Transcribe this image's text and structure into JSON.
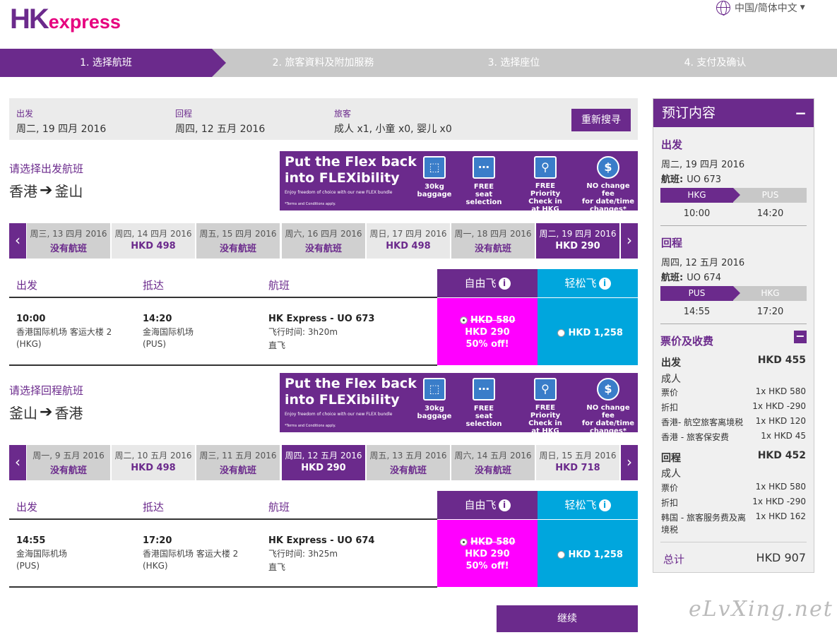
{
  "brand": {
    "logo_hk": "HK",
    "logo_ex": "express"
  },
  "language": {
    "label": "中国/简体中文"
  },
  "steps": [
    "1. 选择航班",
    "2. 旅客資料及附加服務",
    "3. 选择座位",
    "4. 支付及确认"
  ],
  "search": {
    "depart_label": "出发",
    "depart_value": "周二, 19 四月 2016",
    "return_label": "回程",
    "return_value": "周四, 12 五月 2016",
    "pax_label": "旅客",
    "pax_value": "成人 x1, 小童 x0, 婴儿 x0",
    "research_button": "重新搜寻"
  },
  "banner": {
    "title_line1": "Put the Flex back",
    "title_line2": "into FLEXibility",
    "sub": "Enjoy freedom of choice with our new FLEX bundle",
    "terms": "*Terms and Conditions apply.",
    "items": [
      {
        "line1": "30kg",
        "line2": "baggage"
      },
      {
        "line1": "FREE",
        "line2": "seat selection"
      },
      {
        "line1": "FREE",
        "line2": "Priority Check in",
        "line3": "at HKG airport"
      },
      {
        "line1": "NO change fee",
        "line2": "for date/time",
        "line3": "changes*"
      }
    ]
  },
  "outbound": {
    "choose_label": "请选择出发航班",
    "origin": "香港",
    "destination": "釜山",
    "dates": [
      {
        "day": "周三, 13 四月 2016",
        "price": "没有航班"
      },
      {
        "day": "周四, 14 四月 2016",
        "price": "HKD 498"
      },
      {
        "day": "周五, 15 四月 2016",
        "price": "没有航班"
      },
      {
        "day": "周六, 16 四月 2016",
        "price": "没有航班"
      },
      {
        "day": "周日, 17 四月 2016",
        "price": "HKD 498"
      },
      {
        "day": "周一, 18 四月 2016",
        "price": "没有航班"
      },
      {
        "day": "周二, 19 四月 2016",
        "price": "HKD 290"
      }
    ],
    "headers": {
      "depart": "出发",
      "arrive": "抵达",
      "flight": "航班",
      "flex": "自由飞",
      "easy": "轻松飞"
    },
    "flight": {
      "dep_time": "10:00",
      "dep_airport": "香港国际机场 客运大楼 2",
      "dep_code": "(HKG)",
      "arr_time": "14:20",
      "arr_airport": "金海国际机场",
      "arr_code": "(PUS)",
      "name": "HK Express - UO 673",
      "duration": "飞行时间: 3h20m",
      "type": "直飞",
      "flex_old": "HKD 580",
      "flex_price": "HKD 290",
      "flex_off": "50% off!",
      "easy_price": "HKD 1,258"
    }
  },
  "inbound": {
    "choose_label": "请选择回程航班",
    "origin": "釜山",
    "destination": "香港",
    "dates": [
      {
        "day": "周一, 9 五月 2016",
        "price": "没有航班"
      },
      {
        "day": "周二, 10 五月 2016",
        "price": "HKD 498"
      },
      {
        "day": "周三, 11 五月 2016",
        "price": "没有航班"
      },
      {
        "day": "周四, 12 五月 2016",
        "price": "HKD 290"
      },
      {
        "day": "周五, 13 五月 2016",
        "price": "没有航班"
      },
      {
        "day": "周六, 14 五月 2016",
        "price": "没有航班"
      },
      {
        "day": "周日, 15 五月 2016",
        "price": "HKD 718"
      }
    ],
    "headers": {
      "depart": "出发",
      "arrive": "抵达",
      "flight": "航班",
      "flex": "自由飞",
      "easy": "轻松飞"
    },
    "flight": {
      "dep_time": "14:55",
      "dep_airport": "金海国际机场",
      "dep_code": "(PUS)",
      "arr_time": "17:20",
      "arr_airport": "香港国际机场 客运大楼 2",
      "arr_code": "(HKG)",
      "name": "HK Express - UO 674",
      "duration": "飞行时间: 3h25m",
      "type": "直飞",
      "flex_old": "HKD 580",
      "flex_price": "HKD 290",
      "flex_off": "50% off!",
      "easy_price": "HKD 1,258"
    }
  },
  "continue_button": "继续",
  "summary": {
    "title": "预订内容",
    "collapse": "−",
    "depart_title": "出发",
    "depart_date": "周二, 19 四月 2016",
    "depart_flight_label": "航班:",
    "depart_flight": "UO 673",
    "depart_from": "HKG",
    "depart_to": "PUS",
    "depart_t1": "10:00",
    "depart_t2": "14:20",
    "return_title": "回程",
    "return_date": "周四, 12 五月 2016",
    "return_flight_label": "航班:",
    "return_flight": "UO 674",
    "return_from": "PUS",
    "return_to": "HKG",
    "return_t1": "14:55",
    "return_t2": "17:20",
    "fees_title": "票价及收费",
    "fees_toggle": "−",
    "out_label": "出发",
    "out_total": "HKD 455",
    "out_adult": "成人",
    "out_items": [
      {
        "name": "票价",
        "value": "1x HKD 580"
      },
      {
        "name": "折扣",
        "value": "1x HKD -290"
      },
      {
        "name": "香港- 航空旅客离境税",
        "value": "1x HKD 120"
      },
      {
        "name": "香港 - 旅客保安费",
        "value": "1x HKD 45"
      }
    ],
    "ret_label": "回程",
    "ret_total": "HKD 452",
    "ret_adult": "成人",
    "ret_items": [
      {
        "name": "票价",
        "value": "1x HKD 580"
      },
      {
        "name": "折扣",
        "value": "1x HKD -290"
      },
      {
        "name": "韩国 - 旅客服务费及离",
        "name2": "境税",
        "value": "1x HKD 162"
      }
    ],
    "total_label": "总计",
    "total_value": "HKD 907"
  },
  "watermark": "eLvXing.net"
}
